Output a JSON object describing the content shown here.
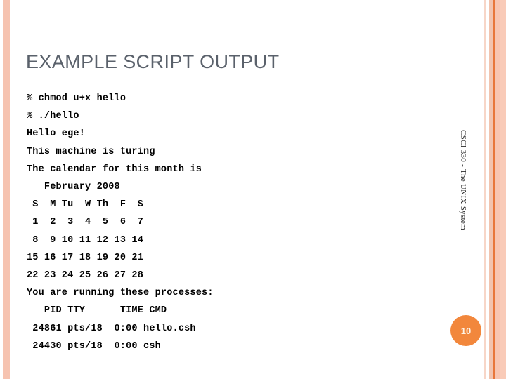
{
  "slide": {
    "title": "EXAMPLE SCRIPT OUTPUT",
    "page_number": "10",
    "running_title": "CSCI 330 - The UNIX System"
  },
  "colors": {
    "title_text": "#5a616b",
    "accent_bar_light": "#f6c3b0",
    "accent_bar_dark": "#e8763a",
    "page_badge_background": "#f2873c",
    "page_badge_text": "#fdf3e6",
    "body_text": "#000000",
    "slide_background": "#ffffff"
  },
  "terminal": {
    "lines": [
      "% chmod u+x hello",
      "% ./hello",
      "Hello ege!",
      "This machine is turing",
      "The calendar for this month is",
      "   February 2008",
      " S  M Tu  W Th  F  S",
      " 1  2  3  4  5  6  7",
      " 8  9 10 11 12 13 14",
      "15 16 17 18 19 20 21",
      "22 23 24 25 26 27 28",
      "You are running these processes:",
      "   PID TTY      TIME CMD",
      " 24861 pts/18  0:00 hello.csh",
      " 24430 pts/18  0:00 csh"
    ]
  },
  "script_output": {
    "commands": [
      {
        "prompt": "%",
        "command": "chmod u+x hello"
      },
      {
        "prompt": "%",
        "command": "./hello"
      }
    ],
    "greeting": "Hello ege!",
    "hostname_line": "This machine is turing",
    "calendar_intro": "The calendar for this month is",
    "calendar": {
      "month_title": "February 2008",
      "month": "February",
      "year": "2008",
      "day_headers": [
        "S",
        "M",
        "Tu",
        "W",
        "Th",
        "F",
        "S"
      ],
      "weeks": [
        [
          "1",
          "2",
          "3",
          "4",
          "5",
          "6",
          "7"
        ],
        [
          "8",
          "9",
          "10",
          "11",
          "12",
          "13",
          "14"
        ],
        [
          "15",
          "16",
          "17",
          "18",
          "19",
          "20",
          "21"
        ],
        [
          "22",
          "23",
          "24",
          "25",
          "26",
          "27",
          "28"
        ]
      ]
    },
    "processes_intro": "You are running these processes:",
    "process_table": {
      "headers": [
        "PID",
        "TTY",
        "TIME",
        "CMD"
      ],
      "rows": [
        [
          "24861",
          "pts/18",
          "0:00",
          "hello.csh"
        ],
        [
          "24430",
          "pts/18",
          "0:00",
          "csh"
        ]
      ]
    }
  }
}
